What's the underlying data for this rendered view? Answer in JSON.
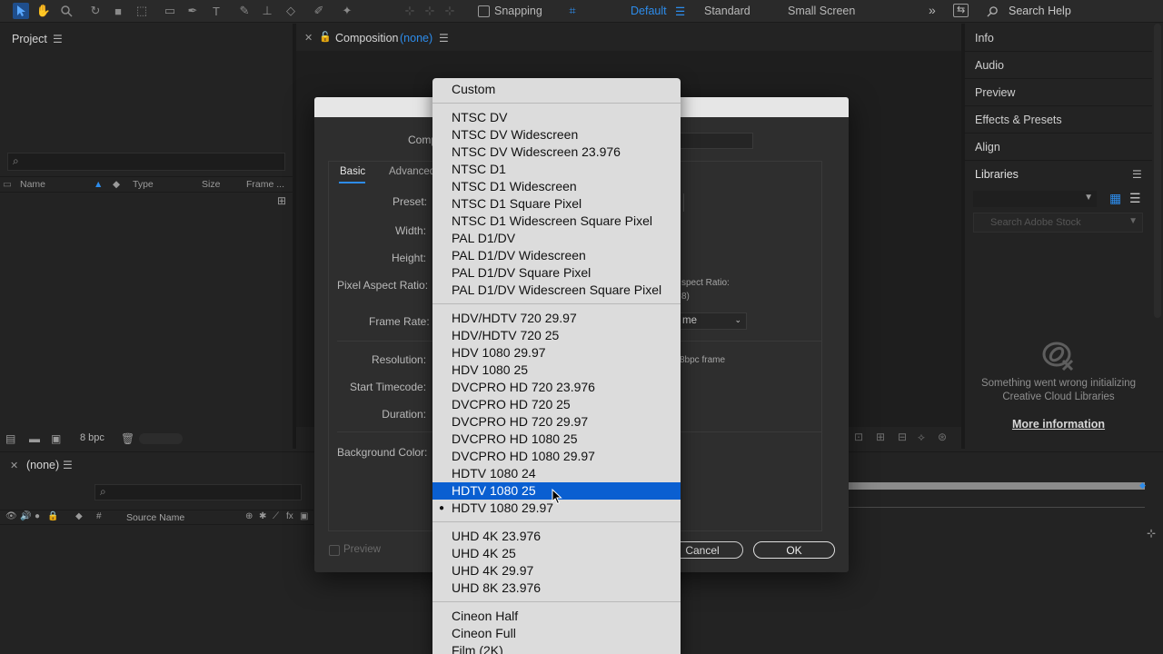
{
  "toolbar": {
    "snapping": "Snapping",
    "workspaces": [
      "Default",
      "Standard",
      "Small Screen"
    ],
    "search_placeholder": "Search Help"
  },
  "project": {
    "title": "Project",
    "columns": [
      "Name",
      "Type",
      "Size",
      "Frame ..."
    ],
    "bpc": "8 bpc"
  },
  "composition": {
    "title_prefix": "Composition",
    "title_name": "(none)"
  },
  "right_panel": {
    "items": [
      "Info",
      "Audio",
      "Preview",
      "Effects & Presets",
      "Align",
      "Libraries"
    ],
    "stock_placeholder": "Search Adobe Stock",
    "error_line1": "Something went wrong initializing",
    "error_line2": "Creative Cloud Libraries",
    "more_info": "More information"
  },
  "timeline": {
    "title": "(none)",
    "source_name": "Source Name"
  },
  "dialog": {
    "comp_label": "Comp",
    "tab_basic": "Basic",
    "tab_advanced": "Advanced",
    "preset_label": "Preset:",
    "width_label": "Width:",
    "height_label": "Height:",
    "par_label": "Pixel Aspect Ratio:",
    "frame_rate_label": "Frame Rate:",
    "resolution_label": "Resolution:",
    "start_tc_label": "Start Timecode:",
    "duration_label": "Duration:",
    "bg_color_label": "Background Color:",
    "aspect_ratio_fragment": "spect Ratio:",
    "aspect_value_fragment": "8)",
    "frame_rate_select": "me",
    "resolution_fragment": "8bpc frame",
    "preview": "Preview",
    "cancel": "Cancel",
    "ok": "OK"
  },
  "preset_menu": {
    "selected": "HDTV 1080 25",
    "checked": "HDTV 1080 29.97",
    "groups": [
      [
        "Custom"
      ],
      [
        "NTSC DV",
        "NTSC DV Widescreen",
        "NTSC DV Widescreen 23.976",
        "NTSC D1",
        "NTSC D1 Widescreen",
        "NTSC D1 Square Pixel",
        "NTSC D1 Widescreen Square Pixel",
        "PAL D1/DV",
        "PAL D1/DV Widescreen",
        "PAL D1/DV Square Pixel",
        "PAL D1/DV Widescreen Square Pixel"
      ],
      [
        "HDV/HDTV 720 29.97",
        "HDV/HDTV 720 25",
        "HDV 1080 29.97",
        "HDV 1080 25",
        "DVCPRO HD 720 23.976",
        "DVCPRO HD 720 25",
        "DVCPRO HD 720 29.97",
        "DVCPRO HD 1080 25",
        "DVCPRO HD 1080 29.97",
        "HDTV 1080 24",
        "HDTV 1080 25",
        "HDTV 1080 29.97"
      ],
      [
        "UHD 4K 23.976",
        "UHD 4K 25",
        "UHD 4K 29.97",
        "UHD 8K 23.976"
      ],
      [
        "Cineon Half",
        "Cineon Full",
        "Film (2K)"
      ]
    ]
  }
}
